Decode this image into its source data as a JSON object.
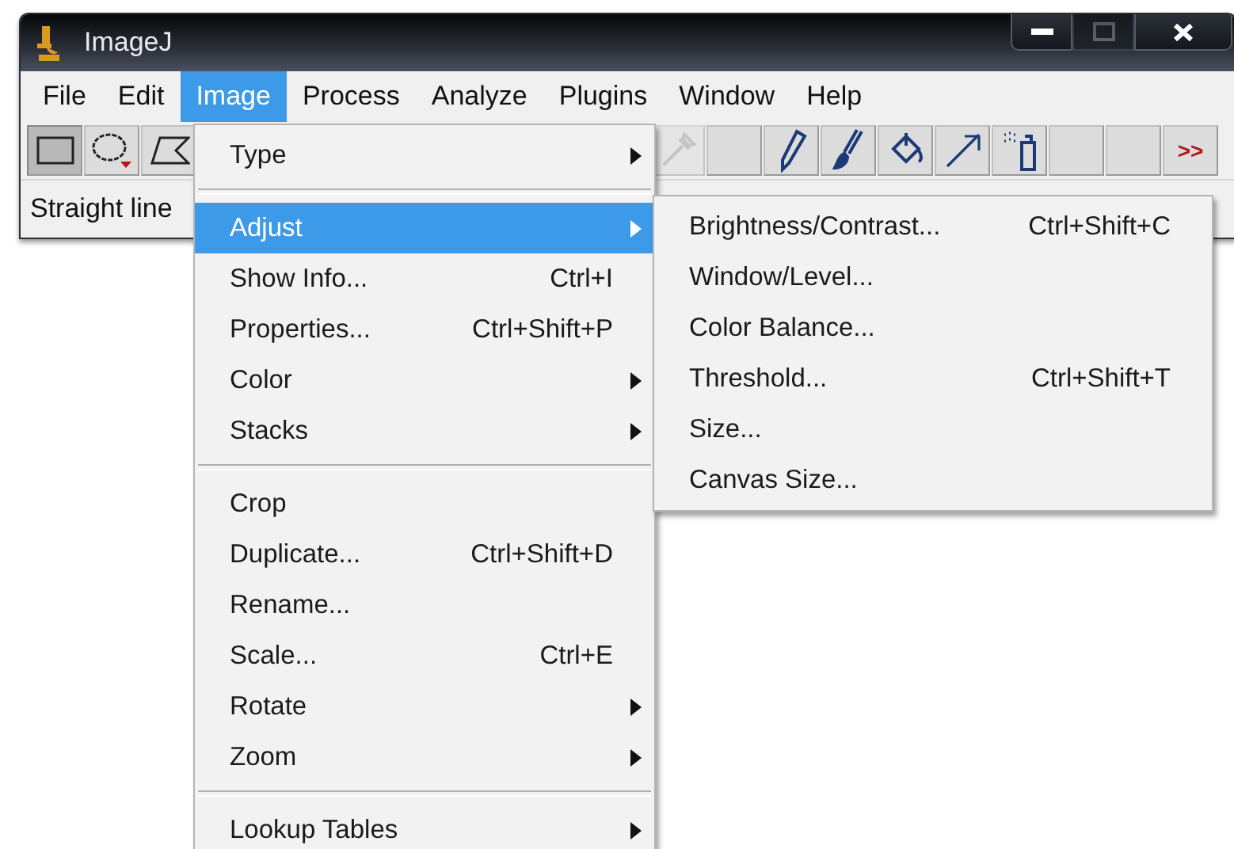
{
  "window": {
    "title": "ImageJ",
    "controls": [
      {
        "kind": "minimize",
        "disabled": false
      },
      {
        "kind": "maximize",
        "disabled": true
      },
      {
        "kind": "close",
        "disabled": false
      }
    ]
  },
  "menubar": [
    {
      "label": "File",
      "selected": false
    },
    {
      "label": "Edit",
      "selected": false
    },
    {
      "label": "Image",
      "selected": true
    },
    {
      "label": "Process",
      "selected": false
    },
    {
      "label": "Analyze",
      "selected": false
    },
    {
      "label": "Plugins",
      "selected": false
    },
    {
      "label": "Window",
      "selected": false
    },
    {
      "label": "Help",
      "selected": false
    }
  ],
  "toolbar": [
    {
      "kind": "rectangle",
      "selected": true,
      "disabled": false
    },
    {
      "kind": "oval",
      "selected": false,
      "disabled": false
    },
    {
      "kind": "polygon",
      "selected": false,
      "disabled": false
    },
    {
      "kind": "hidden"
    },
    {
      "kind": "eyedropper",
      "selected": false,
      "disabled": true
    },
    {
      "kind": "blank",
      "selected": false,
      "disabled": false
    },
    {
      "kind": "pencil",
      "selected": false,
      "disabled": false
    },
    {
      "kind": "brush",
      "selected": false,
      "disabled": false
    },
    {
      "kind": "bucket",
      "selected": false,
      "disabled": false
    },
    {
      "kind": "arrow",
      "selected": false,
      "disabled": false
    },
    {
      "kind": "spray",
      "selected": false,
      "disabled": false
    },
    {
      "kind": "blank",
      "selected": false,
      "disabled": false
    },
    {
      "kind": "blank",
      "selected": false,
      "disabled": false
    },
    {
      "kind": "more",
      "label": ">>",
      "selected": false,
      "disabled": false
    }
  ],
  "status_bar": "Straight line",
  "image_menu": [
    {
      "kind": "item",
      "label": "Type",
      "submenu": true,
      "selected": false
    },
    {
      "kind": "separator"
    },
    {
      "kind": "item",
      "label": "Adjust",
      "submenu": true,
      "selected": true
    },
    {
      "kind": "item",
      "label": "Show Info...",
      "shortcut": "Ctrl+I",
      "submenu": false,
      "selected": false
    },
    {
      "kind": "item",
      "label": "Properties...",
      "shortcut": "Ctrl+Shift+P",
      "submenu": false,
      "selected": false
    },
    {
      "kind": "item",
      "label": "Color",
      "submenu": true,
      "selected": false
    },
    {
      "kind": "item",
      "label": "Stacks",
      "submenu": true,
      "selected": false
    },
    {
      "kind": "separator"
    },
    {
      "kind": "item",
      "label": "Crop",
      "submenu": false,
      "selected": false
    },
    {
      "kind": "item",
      "label": "Duplicate...",
      "shortcut": "Ctrl+Shift+D",
      "submenu": false,
      "selected": false
    },
    {
      "kind": "item",
      "label": "Rename...",
      "submenu": false,
      "selected": false
    },
    {
      "kind": "item",
      "label": "Scale...",
      "shortcut": "Ctrl+E",
      "submenu": false,
      "selected": false
    },
    {
      "kind": "item",
      "label": "Rotate",
      "submenu": true,
      "selected": false
    },
    {
      "kind": "item",
      "label": "Zoom",
      "submenu": true,
      "selected": false
    },
    {
      "kind": "separator"
    },
    {
      "kind": "item",
      "label": "Lookup Tables",
      "submenu": true,
      "selected": false
    }
  ],
  "adjust_menu": [
    {
      "kind": "item",
      "label": "Brightness/Contrast...",
      "shortcut": "Ctrl+Shift+C",
      "submenu": false,
      "selected": false
    },
    {
      "kind": "item",
      "label": "Window/Level...",
      "submenu": false,
      "selected": false
    },
    {
      "kind": "item",
      "label": "Color Balance...",
      "submenu": false,
      "selected": false
    },
    {
      "kind": "item",
      "label": "Threshold...",
      "shortcut": "Ctrl+Shift+T",
      "submenu": false,
      "selected": false
    },
    {
      "kind": "item",
      "label": "Size...",
      "submenu": false,
      "selected": false
    },
    {
      "kind": "item",
      "label": "Canvas Size...",
      "submenu": false,
      "selected": false
    }
  ]
}
